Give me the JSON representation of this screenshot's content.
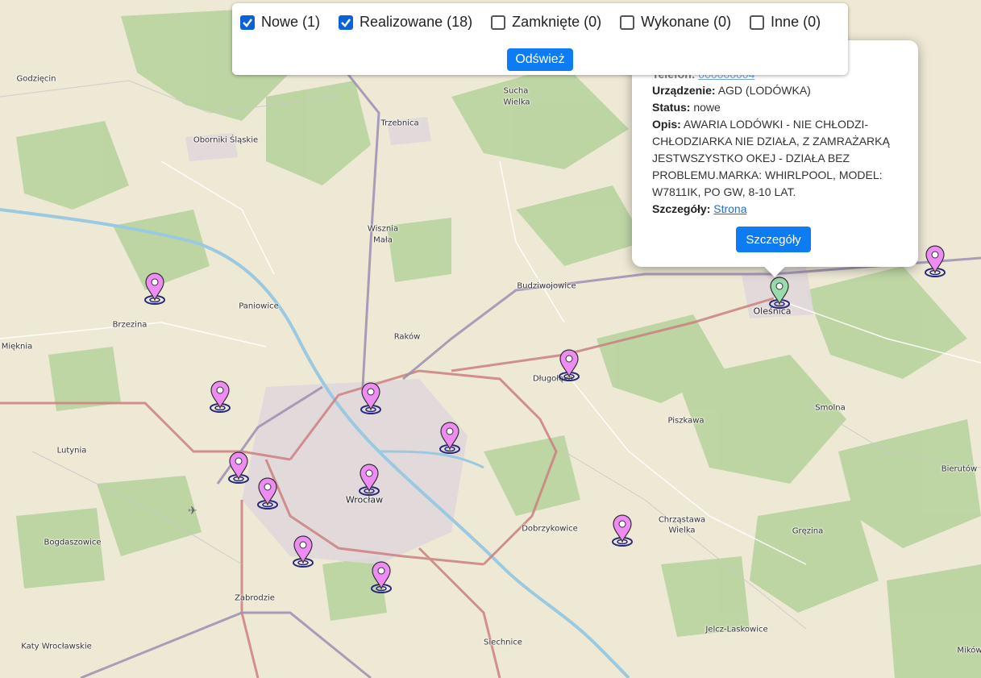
{
  "filters": [
    {
      "label": "Nowe (1)",
      "checked": true
    },
    {
      "label": "Realizowane (18)",
      "checked": true
    },
    {
      "label": "Zamknięte (0)",
      "checked": false
    },
    {
      "label": "Wykonane (0)",
      "checked": false
    },
    {
      "label": "Inne (0)",
      "checked": false
    }
  ],
  "refresh_label": "Odśwież",
  "popup": {
    "phone_label": "Telefon:",
    "phone_value": "000000004",
    "device_label": "Urządzenie:",
    "device_value": "AGD (LODÓWKA)",
    "status_label": "Status:",
    "status_value": "nowe",
    "desc_label": "Opis:",
    "desc_lines": [
      "AWARIA LODÓWKI - NIE CHŁODZI-",
      "CHŁODZIARKA NIE DZIAŁA, Z ZAMRAŻARKĄ",
      "JESTWSZYSTKO OKEJ - DZIAŁA BEZ",
      "PROBLEMU.MARKA: WHIRLPOOL, MODEL:",
      "W7811IK, PO GW, 8-10 LAT."
    ],
    "details_label": "Szczegóły:",
    "details_link": "Strona",
    "details_button": "Szczegóły"
  },
  "places": [
    {
      "name": "Godzięcin"
    },
    {
      "name": "Oborniki Śląskie"
    },
    {
      "name": "Trzebnica"
    },
    {
      "name": "Sucha"
    },
    {
      "name": "Wielka"
    },
    {
      "name": "Wisznia"
    },
    {
      "name": "Mała"
    },
    {
      "name": "Paniowice"
    },
    {
      "name": "Brzezina"
    },
    {
      "name": "Mięknia"
    },
    {
      "name": "Raków"
    },
    {
      "name": "Budziwojowice"
    },
    {
      "name": "Oleśnica"
    },
    {
      "name": "Długołęka"
    },
    {
      "name": "Piszkawa"
    },
    {
      "name": "Smolna"
    },
    {
      "name": "Bierutów"
    },
    {
      "name": "Lutynia"
    },
    {
      "name": "Wrocław"
    },
    {
      "name": "Dobrzykowice"
    },
    {
      "name": "Chrząstawa"
    },
    {
      "name": "Wielka"
    },
    {
      "name": "Gręzina"
    },
    {
      "name": "Bogdaszowice"
    },
    {
      "name": "Zabrodzie"
    },
    {
      "name": "Katy Wrocławskie"
    },
    {
      "name": "Siechnice"
    },
    {
      "name": "Jelcz-Laskowice"
    },
    {
      "name": "Mików"
    }
  ],
  "markers": [
    {
      "status": "realizowane",
      "color": "#ee8cf3"
    },
    {
      "status": "realizowane",
      "color": "#ee8cf3"
    },
    {
      "status": "realizowane",
      "color": "#ee8cf3"
    },
    {
      "status": "realizowane",
      "color": "#ee8cf3"
    },
    {
      "status": "realizowane",
      "color": "#ee8cf3"
    },
    {
      "status": "realizowane",
      "color": "#ee8cf3"
    },
    {
      "status": "realizowane",
      "color": "#ee8cf3"
    },
    {
      "status": "realizowane",
      "color": "#ee8cf3"
    },
    {
      "status": "realizowane",
      "color": "#ee8cf3"
    },
    {
      "status": "realizowane",
      "color": "#ee8cf3"
    },
    {
      "status": "realizowane",
      "color": "#ee8cf3"
    },
    {
      "status": "realizowane",
      "color": "#ee8cf3"
    },
    {
      "status": "realizowane",
      "color": "#ee8cf3"
    },
    {
      "status": "realizowane",
      "color": "#ee8cf3"
    },
    {
      "status": "nowe",
      "color": "#98dcae"
    }
  ]
}
